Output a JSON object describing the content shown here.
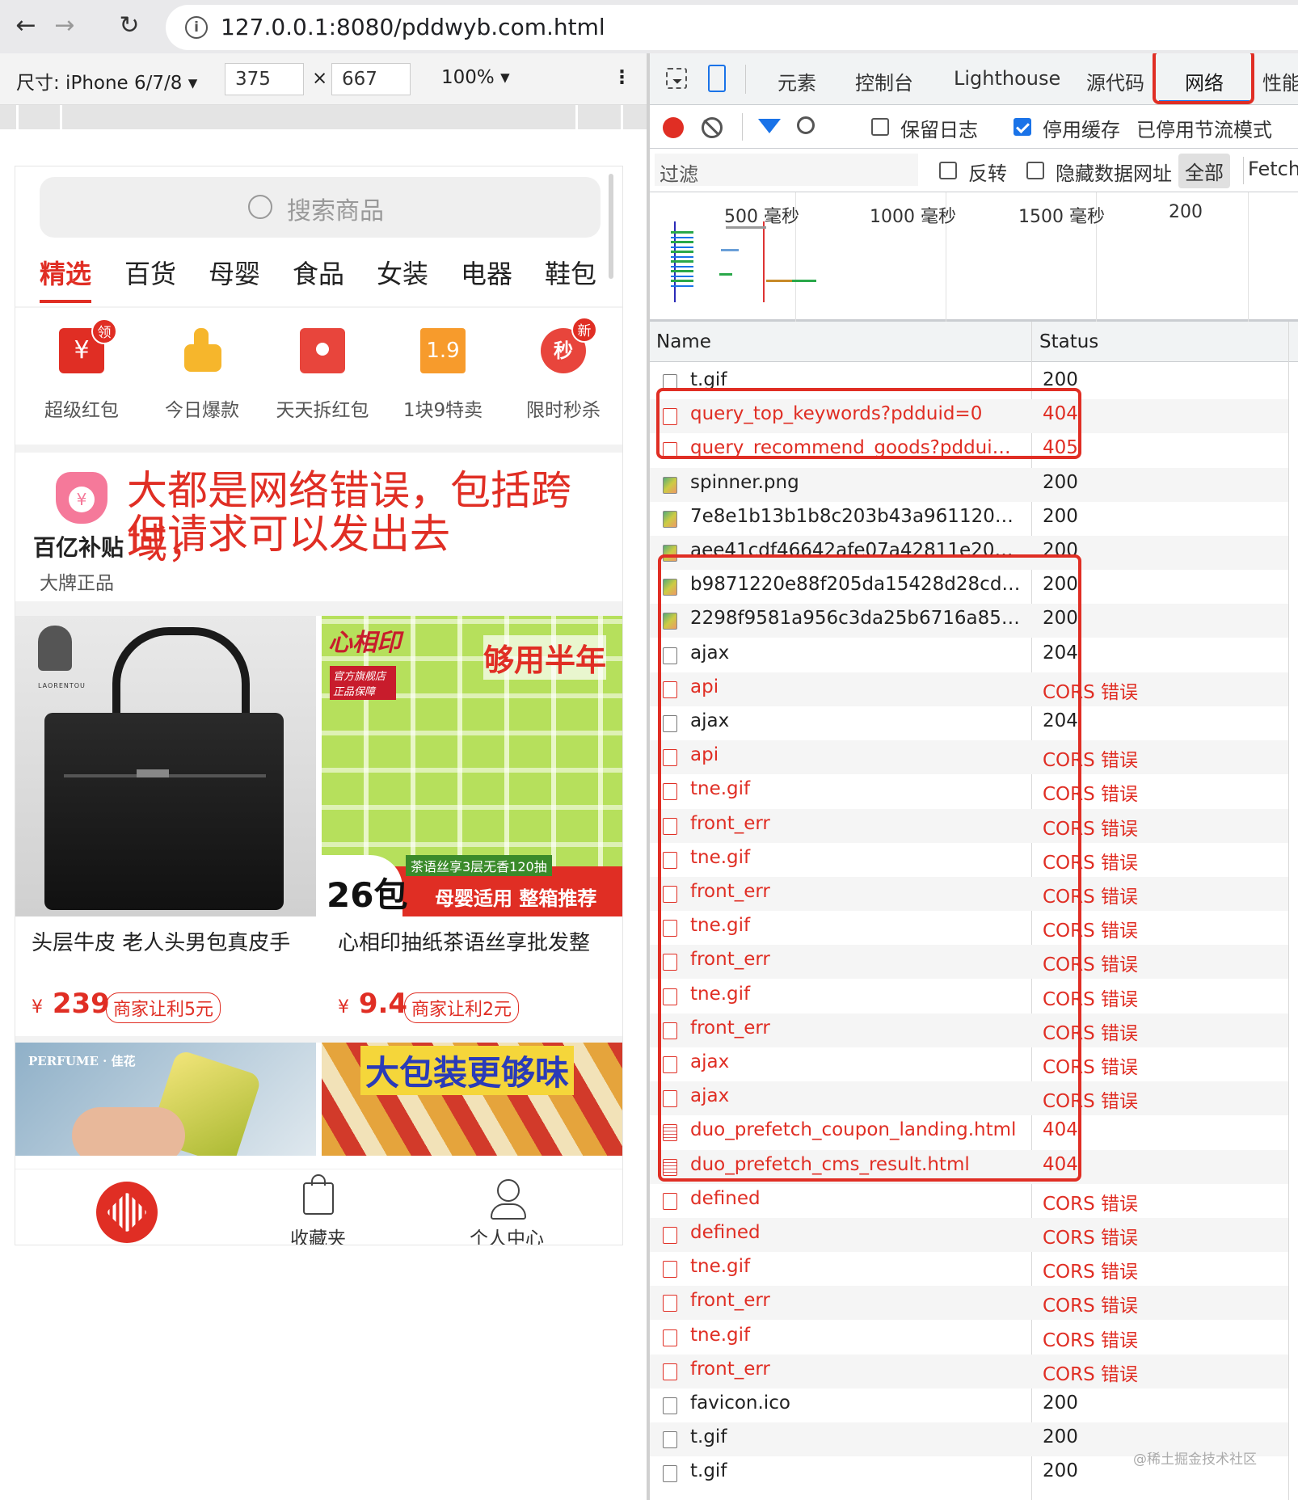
{
  "browser": {
    "url": "127.0.0.1:8080/pddwyb.com.html"
  },
  "device_toolbar": {
    "size_label": "尺寸: iPhone 6/7/8 ▾",
    "width": "375",
    "times": "×",
    "height": "667",
    "zoom": "100% ▾"
  },
  "phone": {
    "search_placeholder": "搜索商品",
    "categories": [
      "精选",
      "百货",
      "母婴",
      "食品",
      "女装",
      "电器",
      "鞋包"
    ],
    "icons": [
      {
        "label": "超级红包",
        "badge": "领"
      },
      {
        "label": "今日爆款",
        "badge": ""
      },
      {
        "label": "天天拆红包",
        "badge": ""
      },
      {
        "label": "1块9特卖",
        "badge": "",
        "text": "1.9"
      },
      {
        "label": "限时秒杀",
        "badge": "新",
        "text": "秒"
      }
    ],
    "subsidy": {
      "title": "百亿补贴",
      "subtitle": "大牌正品",
      "annotation_line1": "大都是网络错误，包括跨域，",
      "annotation_line2": "但请求可以发出去"
    },
    "products": [
      {
        "title": "头层牛皮 老人头男包真皮手",
        "currency": "¥",
        "price": "239",
        "tag": "商家让利5元",
        "brand": "LAORENTOU"
      },
      {
        "title": "心相印抽纸茶语丝享批发整",
        "currency": "¥",
        "price": "9.4",
        "tag": "商家让利2元",
        "brand": "心相印",
        "overlay1": "够用半年",
        "overlay2": "26包",
        "overlay3": "母婴适用 整箱推荐",
        "overlay4": "茶语丝享3层无香120抽",
        "overlay5": "官方旗舰店 正品保障"
      }
    ],
    "products_row2": [
      {
        "overlay": "PERFUME · 佳花"
      },
      {
        "overlay": "大包装更够味"
      }
    ],
    "tabbar": [
      "收藏夹",
      "个人中心"
    ]
  },
  "devtools": {
    "tabs": [
      "元素",
      "控制台",
      "Lighthouse",
      "源代码",
      "网络",
      "性能"
    ],
    "active_tab": "网络",
    "toolbar": {
      "preserve_log": "保留日志",
      "disable_cache": "停用缓存",
      "throttling": "已停用节流模式"
    },
    "filter": {
      "placeholder": "过滤",
      "invert": "反转",
      "hide_data_urls": "隐藏数据网址",
      "all": "全部",
      "fetch": "Fetch/"
    },
    "overview_labels": [
      "500 毫秒",
      "1000 毫秒",
      "1500 毫秒",
      "200"
    ],
    "columns": [
      "Name",
      "Status"
    ],
    "requests": [
      {
        "name": "t.gif",
        "status": "200",
        "error": false,
        "type": "blank"
      },
      {
        "name": "query_top_keywords?pdduid=0",
        "status": "404",
        "error": true,
        "type": "blank"
      },
      {
        "name": "query_recommend_goods?pdduid=0",
        "status": "405",
        "error": true,
        "type": "blank"
      },
      {
        "name": "spinner.png",
        "status": "200",
        "error": false,
        "type": "img"
      },
      {
        "name": "7e8e1b13b1b8c203b43a9611206fa...",
        "status": "200",
        "error": false,
        "type": "img"
      },
      {
        "name": "aee41cdf46642afe07a42811e20d2a...",
        "status": "200",
        "error": false,
        "type": "img"
      },
      {
        "name": "b9871220e88f205da15428d28cdd9...",
        "status": "200",
        "error": false,
        "type": "img"
      },
      {
        "name": "2298f9581a956c3da25b6716a8560...",
        "status": "200",
        "error": false,
        "type": "img"
      },
      {
        "name": "ajax",
        "status": "204",
        "error": false,
        "type": "blank"
      },
      {
        "name": "api",
        "status": "CORS 错误",
        "error": true,
        "type": "blank"
      },
      {
        "name": "ajax",
        "status": "204",
        "error": false,
        "type": "blank"
      },
      {
        "name": "api",
        "status": "CORS 错误",
        "error": true,
        "type": "blank"
      },
      {
        "name": "tne.gif",
        "status": "CORS 错误",
        "error": true,
        "type": "blank"
      },
      {
        "name": "front_err",
        "status": "CORS 错误",
        "error": true,
        "type": "blank"
      },
      {
        "name": "tne.gif",
        "status": "CORS 错误",
        "error": true,
        "type": "blank"
      },
      {
        "name": "front_err",
        "status": "CORS 错误",
        "error": true,
        "type": "blank"
      },
      {
        "name": "tne.gif",
        "status": "CORS 错误",
        "error": true,
        "type": "blank"
      },
      {
        "name": "front_err",
        "status": "CORS 错误",
        "error": true,
        "type": "blank"
      },
      {
        "name": "tne.gif",
        "status": "CORS 错误",
        "error": true,
        "type": "blank"
      },
      {
        "name": "front_err",
        "status": "CORS 错误",
        "error": true,
        "type": "blank"
      },
      {
        "name": "ajax",
        "status": "CORS 错误",
        "error": true,
        "type": "blank"
      },
      {
        "name": "ajax",
        "status": "CORS 错误",
        "error": true,
        "type": "blank"
      },
      {
        "name": "duo_prefetch_coupon_landing.html",
        "status": "404",
        "error": true,
        "type": "doc"
      },
      {
        "name": "duo_prefetch_cms_result.html",
        "status": "404",
        "error": true,
        "type": "doc"
      },
      {
        "name": "defined",
        "status": "CORS 错误",
        "error": true,
        "type": "blank"
      },
      {
        "name": "defined",
        "status": "CORS 错误",
        "error": true,
        "type": "blank"
      },
      {
        "name": "tne.gif",
        "status": "CORS 错误",
        "error": true,
        "type": "blank"
      },
      {
        "name": "front_err",
        "status": "CORS 错误",
        "error": true,
        "type": "blank"
      },
      {
        "name": "tne.gif",
        "status": "CORS 错误",
        "error": true,
        "type": "blank"
      },
      {
        "name": "front_err",
        "status": "CORS 错误",
        "error": true,
        "type": "blank"
      },
      {
        "name": "favicon.ico",
        "status": "200",
        "error": false,
        "type": "blank"
      },
      {
        "name": "t.gif",
        "status": "200",
        "error": false,
        "type": "blank"
      },
      {
        "name": "t.gif",
        "status": "200",
        "error": false,
        "type": "blank"
      }
    ]
  },
  "watermark": "@稀土掘金技术社区",
  "colors": {
    "accent": "#e02e24",
    "blue": "#1a73e8"
  }
}
